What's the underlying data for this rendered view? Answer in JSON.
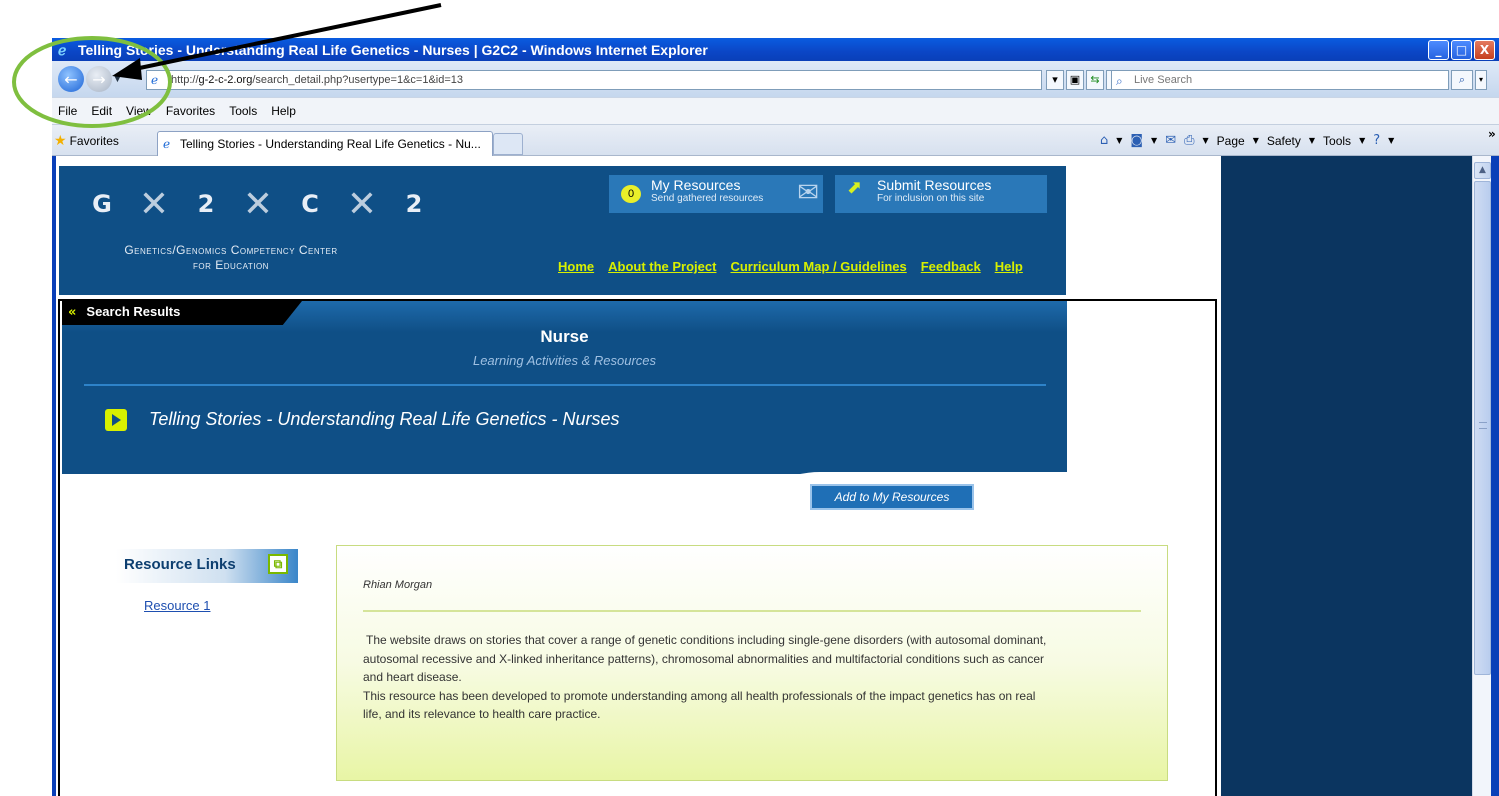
{
  "window": {
    "title": "Telling Stories - Understanding Real Life Genetics - Nurses | G2C2 - Windows Internet Explorer",
    "buttons": [
      "_",
      "□",
      "X"
    ]
  },
  "address_bar": {
    "url_prefix": "http://",
    "url_domain": "g-2-c-2.org",
    "url_path": "/search_detail.php?usertype=1&c=1&id=13",
    "search_placeholder": "Live Search"
  },
  "menu": [
    "File",
    "Edit",
    "View",
    "Favorites",
    "Tools",
    "Help"
  ],
  "favorites_bar": {
    "favorites_label": "Favorites",
    "tab_label": "Telling Stories - Understanding Real Life Genetics - Nu...",
    "commands": [
      "Page",
      "Safety",
      "Tools"
    ]
  },
  "site": {
    "logo_letters": [
      "G",
      "2",
      "C",
      "2"
    ],
    "org_line1": "Genetics/Genomics Competency Center",
    "org_line2": "for Education",
    "my_resources": {
      "count": "0",
      "title": "My Resources",
      "subtitle": "Send gathered resources"
    },
    "submit_resources": {
      "title": "Submit Resources",
      "subtitle": "For inclusion on this site"
    },
    "nav": [
      "Home",
      "About the Project",
      "Curriculum Map / Guidelines",
      "Feedback",
      "Help"
    ]
  },
  "banner": {
    "search_results_tab": "Search Results",
    "title": "Nurse",
    "subtitle": "Learning Activities & Resources",
    "resource_title": "Telling Stories - Understanding Real Life Genetics - Nurses",
    "add_button": "Add to My Resources"
  },
  "resource_links": {
    "heading": "Resource Links",
    "links": [
      "Resource 1"
    ]
  },
  "description": {
    "author": "Rhian Morgan",
    "paragraph1": "The website draws on stories that cover a range of genetic conditions including single-gene disorders (with autosomal dominant, autosomal recessive and X-linked inheritance patterns), chromosomal abnormalities and multifactorial conditions such as cancer and heart disease.",
    "paragraph2": "This resource has been developed to promote understanding among all health professionals of the impact genetics has on real life, and its relevance to health care practice."
  },
  "colors": {
    "header_blue": "#0f4f86",
    "accent_lime": "#d8f000",
    "annotation_green": "#7fbf3f"
  }
}
